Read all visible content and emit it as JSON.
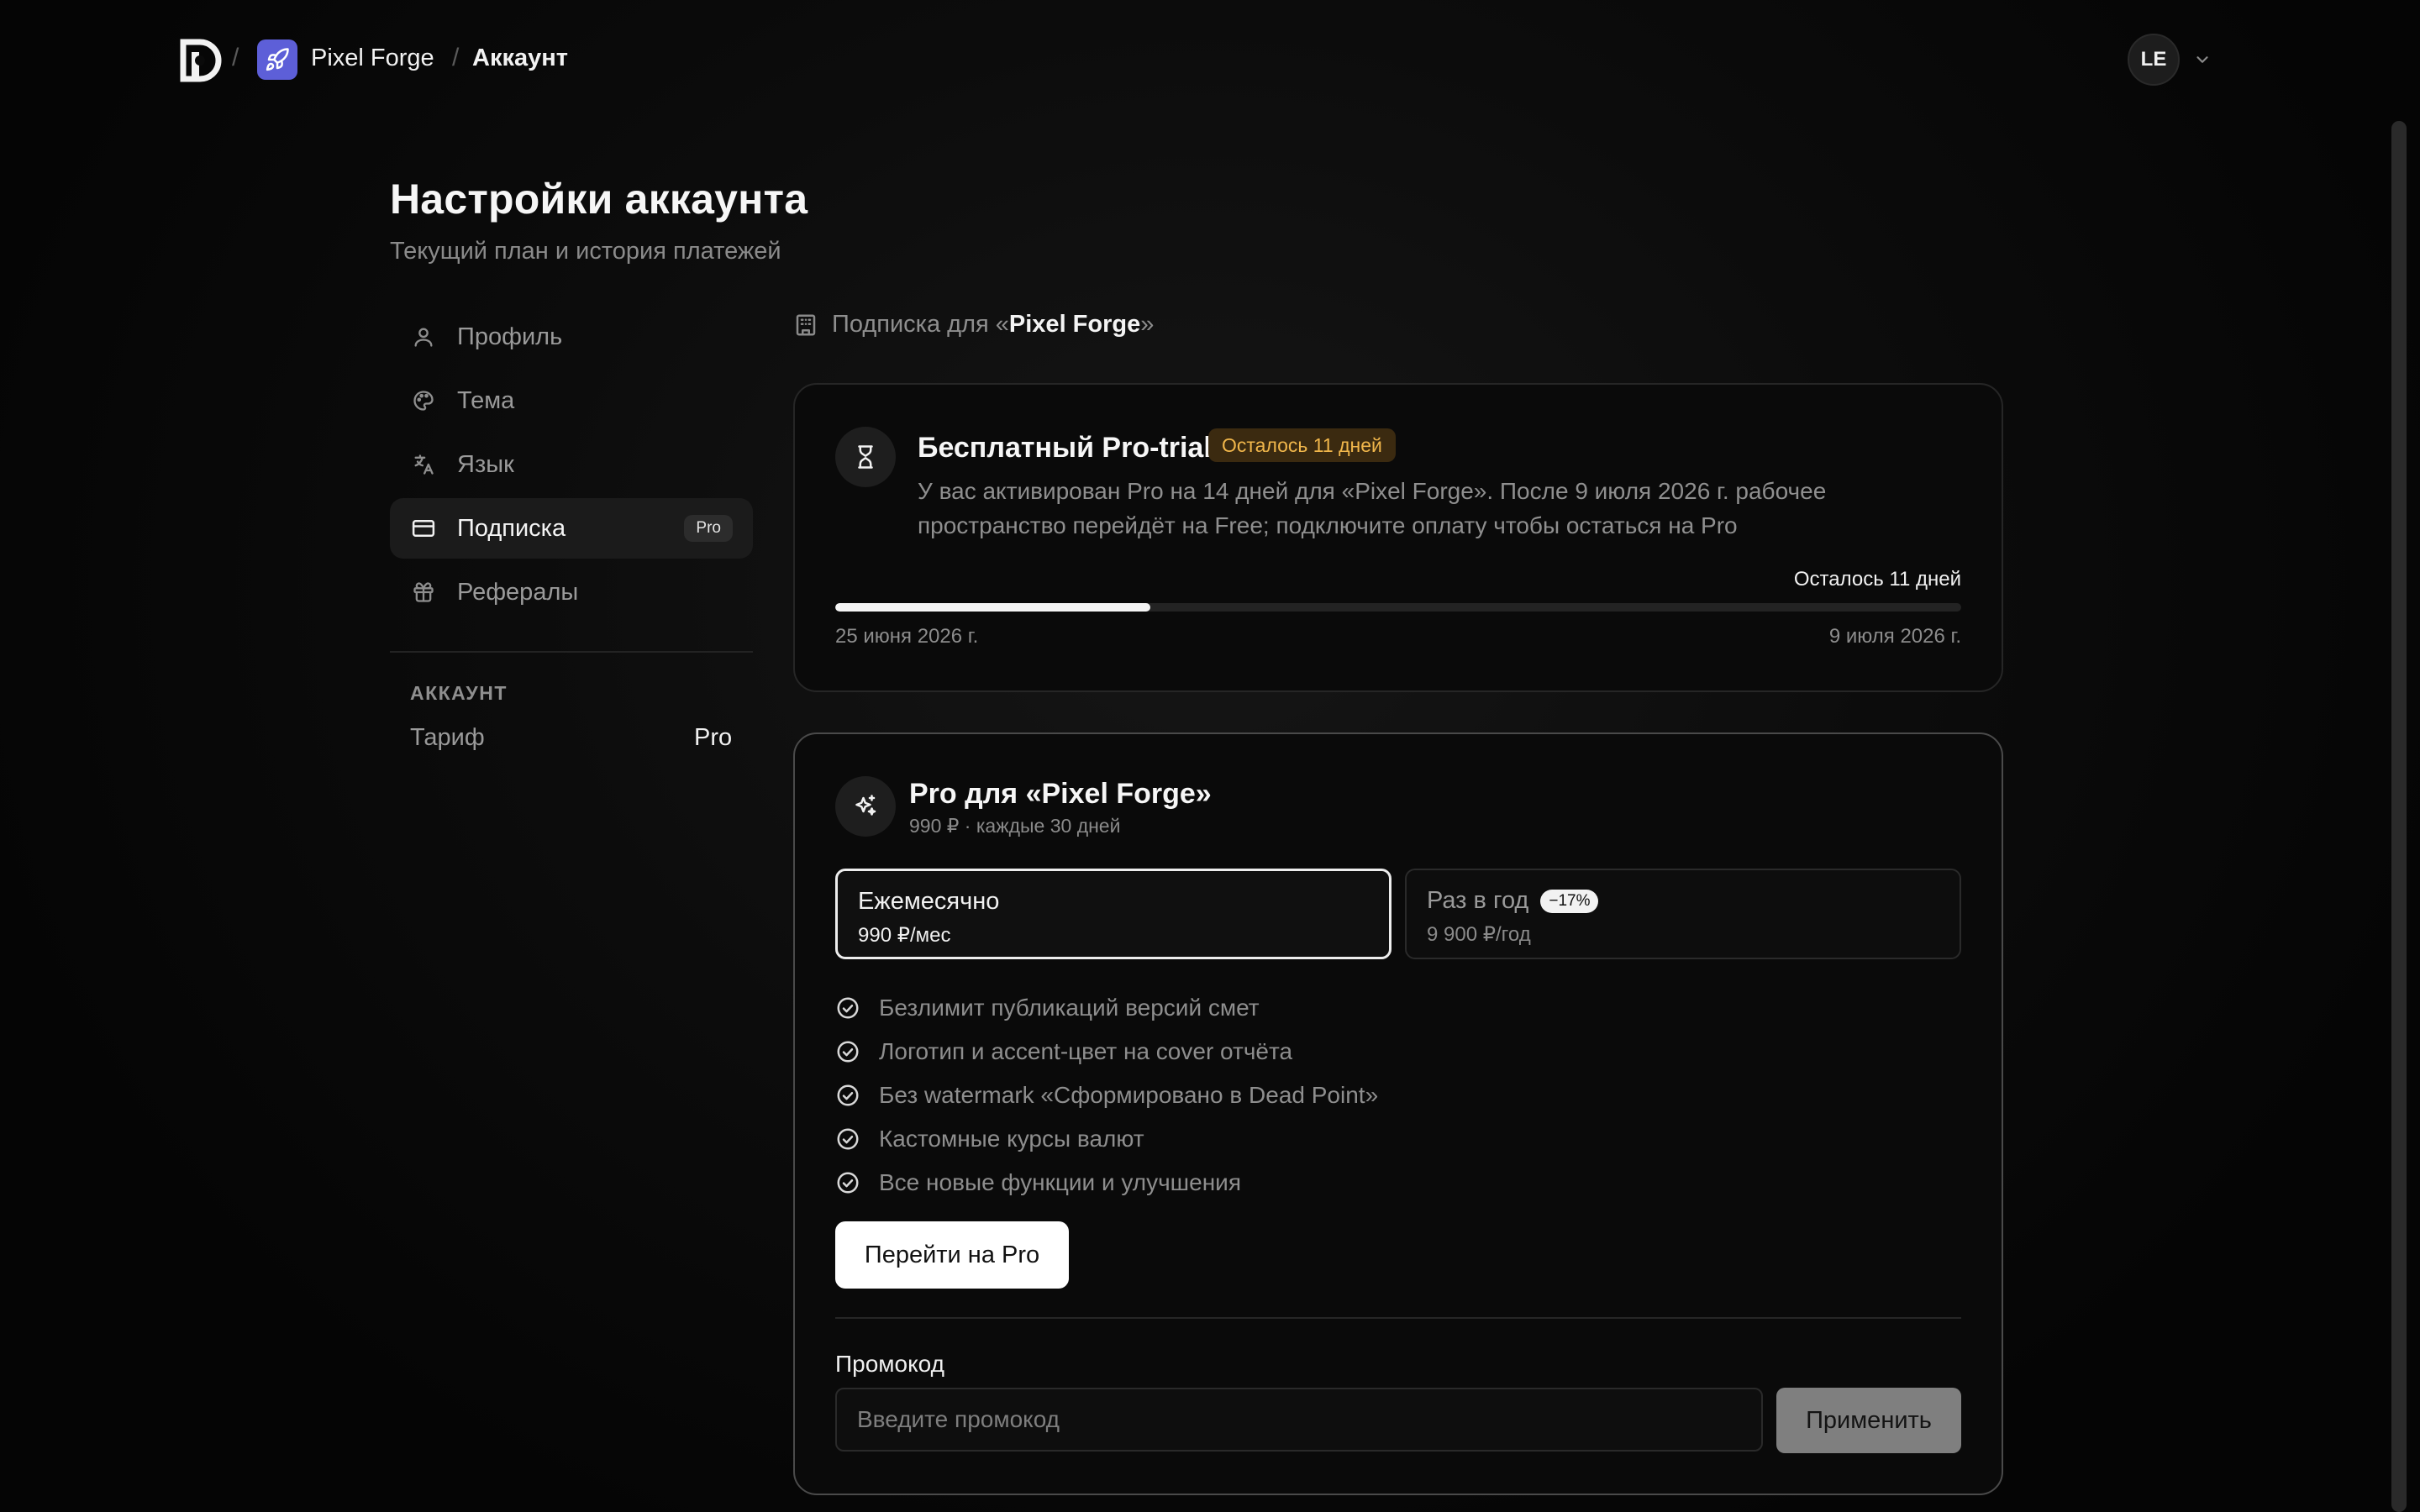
{
  "header": {
    "separator": "/",
    "workspace": "Pixel Forge",
    "current": "Аккаунт",
    "avatar_initials": "LE"
  },
  "page": {
    "title": "Настройки аккаунта",
    "subtitle": "Текущий план и история платежей"
  },
  "sidebar": {
    "items": [
      {
        "label": "Профиль",
        "icon": "user-icon"
      },
      {
        "label": "Тема",
        "icon": "palette-icon"
      },
      {
        "label": "Язык",
        "icon": "translate-icon"
      },
      {
        "label": "Подписка",
        "icon": "credit-card-icon",
        "badge": "Pro",
        "active": true
      },
      {
        "label": "Рефералы",
        "icon": "gift-icon"
      }
    ],
    "section_title": "АККАУНТ",
    "plan_label": "Тариф",
    "plan_value": "Pro"
  },
  "subscription": {
    "prefix": "Подписка для «",
    "workspace": "Pixel Forge",
    "suffix": "»"
  },
  "trial": {
    "title": "Бесплатный Pro-trial",
    "badge": "Осталось 11 дней",
    "description": "У вас активирован Pro на 14 дней для «Pixel Forge». После 9 июля 2026 г. рабочее пространство перейдёт на Free; подключите оплату чтобы остаться на Pro",
    "remaining": "Осталось 11 дней",
    "progress_fraction": 0.28,
    "start_date": "25 июня 2026 г.",
    "end_date": "9 июля 2026 г."
  },
  "pro": {
    "title": "Pro для «Pixel Forge»",
    "price_line": "990 ₽ · каждые 30 дней",
    "plans": [
      {
        "name": "Ежемесячно",
        "price": "990 ₽/мес",
        "selected": true
      },
      {
        "name": "Раз в год",
        "price": "9 900 ₽/год",
        "discount": "−17%",
        "selected": false
      }
    ],
    "features": [
      "Безлимит публикаций версий смет",
      "Логотип и accent-цвет на cover отчёта",
      "Без watermark «Сформировано в Dead Point»",
      "Кастомные курсы валют",
      "Все новые функции и улучшения"
    ],
    "cta": "Перейти на Pro",
    "promo_label": "Промокод",
    "promo_placeholder": "Введите промокод",
    "apply": "Применить"
  },
  "colors": {
    "accent_workspace": "#5d5fd8",
    "trial_badge_bg": "#3b2a10",
    "trial_badge_text": "#f0b64b"
  }
}
